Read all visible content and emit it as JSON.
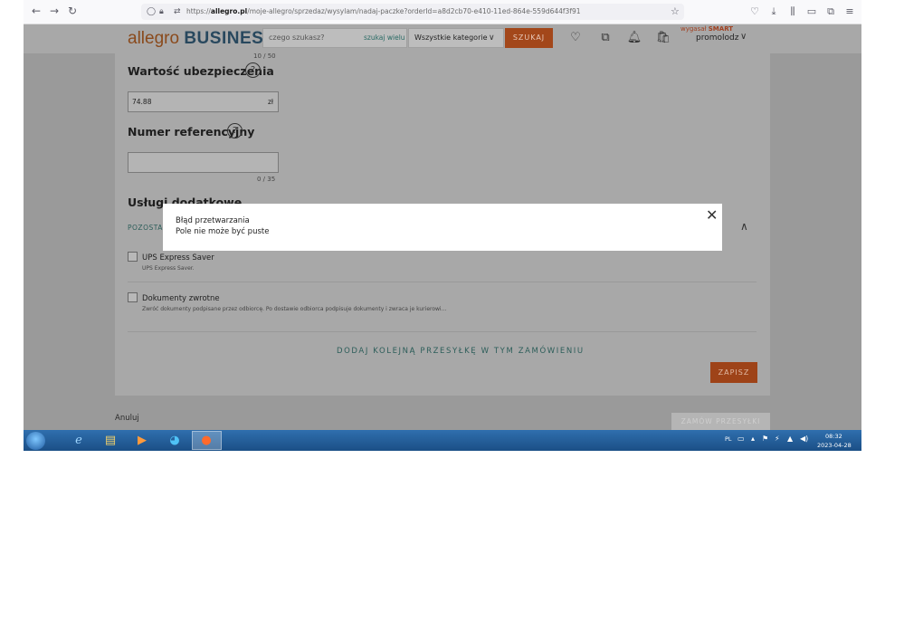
{
  "browser": {
    "url_prefix": "https://",
    "url_host": "allegro.pl",
    "url_path": "/moje-allegro/sprzedaz/wysylam/nadaj-paczke?orderId=a8d2cb70-e410-11ed-864e-559d644f3f91"
  },
  "header": {
    "logo_allegro": "allegro",
    "logo_business": "BUSINESS",
    "search_placeholder": "czego szukasz?",
    "search_many": "szukaj wielu",
    "category": "Wszystkie kategorie",
    "search_button": "SZUKAJ",
    "smart_expired": "wygasał",
    "smart_label": "SMART",
    "username": "promolodz"
  },
  "form": {
    "top_counter": "10 / 50",
    "insurance_label": "Wartość ubezpieczenia",
    "insurance_value": "74.88",
    "insurance_currency": "zł",
    "reference_label": "Numer referencyjny",
    "reference_value": "",
    "reference_counter": "0 / 35",
    "additional_services_label": "Usługi dodatkowe",
    "other_section_label": "POZOSTAŁE",
    "services": [
      {
        "name": "UPS Express Saver",
        "description": "UPS Express Saver."
      },
      {
        "name": "Dokumenty zwrotne",
        "description": "Zwróć dokumenty podpisane przez odbiorcę. Po dostawie odbiorca podpisuje dokumenty i zwraca je kurierowi..."
      }
    ],
    "add_shipment": "DODAJ KOLEJNĄ PRZESYŁKĘ W TYM ZAMÓWIENIU",
    "save_button": "ZAPISZ",
    "cancel_link": "Anuluj",
    "order_button": "ZAMÓW PRZESYŁKI"
  },
  "modal": {
    "title": "Błąd przetwarzania",
    "message": "Pole nie może być puste"
  },
  "taskbar": {
    "language": "PL",
    "time": "08:32",
    "date": "2023-04-28"
  },
  "colors": {
    "accent_orange": "#a3471a",
    "teal_link": "#2d5e5a"
  }
}
